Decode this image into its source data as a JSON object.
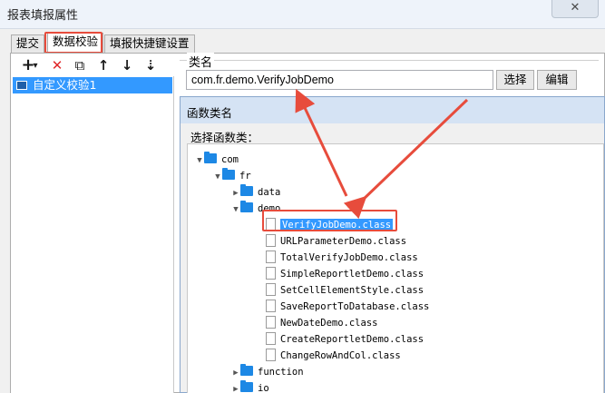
{
  "window": {
    "title": "报表填报属性",
    "close_glyph": "✕"
  },
  "tabs": [
    {
      "label": "提交"
    },
    {
      "label": "数据校验"
    },
    {
      "label": "填报快捷键设置"
    }
  ],
  "toolbar": {
    "add_glyph": "+",
    "dropdown_glyph": "▾",
    "delete_glyph": "✕",
    "copy_glyph": "⧉",
    "up_glyph": "↑",
    "down_glyph": "↓",
    "sort_glyph": "⇣"
  },
  "list": {
    "items": [
      {
        "label": "自定义校验1"
      }
    ]
  },
  "classname": {
    "label": "类名",
    "value": "com.fr.demo.VerifyJobDemo",
    "select_button": "选择",
    "edit_button": "编辑"
  },
  "dialog": {
    "title": "函数类名",
    "prompt": "选择函数类：",
    "tree": {
      "com": "com",
      "fr": "fr",
      "data": "data",
      "demo": "demo",
      "demo_files": [
        "VerifyJobDemo.class",
        "URLParameterDemo.class",
        "TotalVerifyJobDemo.class",
        "SimpleReportletDemo.class",
        "SetCellElementStyle.class",
        "SaveReportToDatabase.class",
        "NewDateDemo.class",
        "CreateReportletDemo.class",
        "ChangeRowAndCol.class"
      ],
      "function": "function",
      "io": "io"
    }
  },
  "colors": {
    "highlight_red": "#e74c3c",
    "selection_blue": "#3399ff",
    "folder_blue": "#1d88e5"
  }
}
